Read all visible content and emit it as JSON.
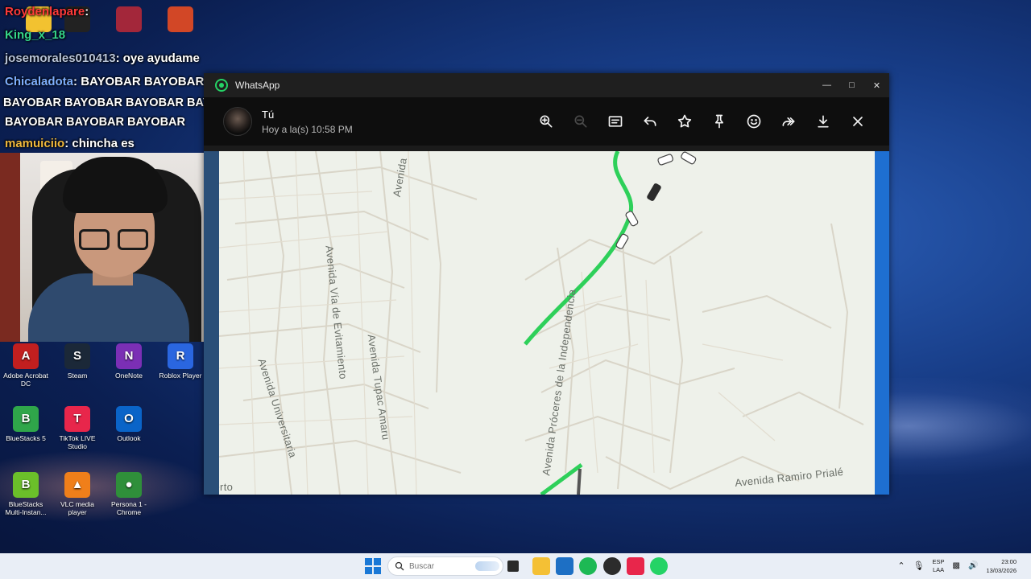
{
  "chat": [
    {
      "user": "Roydenlapare",
      "text": ":",
      "color": "#ff3a3a"
    },
    {
      "user": "King_x_18",
      "text": "",
      "color": "#35d68a"
    },
    {
      "user": "josemorales010413",
      "text": ": oye ayudame",
      "color": "#b8c4d8"
    },
    {
      "user": "Chicaladota",
      "text": ": BAYOBAR BAYOBAR",
      "color": "#7fb0ff"
    },
    {
      "user": "",
      "text": "BAYOBAR BAYOBAR BAYOBAR BAYOBAR",
      "color": "#ffffff"
    },
    {
      "user": "",
      "text": "BAYOBAR BAYOBAR BAYOBAR",
      "color": "#ffffff"
    },
    {
      "user": "mamuiciio",
      "text": ": chincha es",
      "color": "#f0b83c"
    }
  ],
  "desktop_icons": [
    {
      "label": "Adobe Acrobat DC",
      "icon": "acrobat-icon",
      "color": "#c21f1f",
      "glyph": "A"
    },
    {
      "label": "Steam",
      "icon": "steam-icon",
      "color": "#1b2838",
      "glyph": "S"
    },
    {
      "label": "OneNote",
      "icon": "onenote-icon",
      "color": "#7b2fb5",
      "glyph": "N"
    },
    {
      "label": "Roblox Player",
      "icon": "roblox-icon",
      "color": "#2a66e0",
      "glyph": "R"
    },
    {
      "label": "BlueStacks 5",
      "icon": "bluestacks-icon",
      "color": "#2fa64a",
      "glyph": "B"
    },
    {
      "label": "TikTok LIVE Studio",
      "icon": "tiktok-icon",
      "color": "#e8264b",
      "glyph": "T"
    },
    {
      "label": "Outlook",
      "icon": "outlook-icon",
      "color": "#0a64c8",
      "glyph": "O"
    },
    {
      "label": "BlueStacks Multi-Instan...",
      "icon": "bluestacks-multi-icon",
      "color": "#6bbf2a",
      "glyph": "B"
    },
    {
      "label": "VLC media player",
      "icon": "vlc-icon",
      "color": "#f07f1a",
      "glyph": "▲"
    },
    {
      "label": "Persona 1 - Chrome",
      "icon": "chrome-icon",
      "color": "#2f8f3a",
      "glyph": "●"
    }
  ],
  "whatsapp": {
    "window_title": "WhatsApp",
    "sender_name": "Tú",
    "sender_time": "Hoy a la(s) 10:58 PM",
    "toolbar": [
      "zoom-in-icon",
      "zoom-out-icon",
      "caption-icon",
      "reply-icon",
      "star-icon",
      "pin-icon",
      "react-icon",
      "forward-icon",
      "download-icon",
      "close-icon"
    ],
    "accent": "#25d366"
  },
  "map": {
    "labels": {
      "avenida": "Avenida",
      "via_evitamiento": "Avenida Vía de Evitamiento",
      "tupac_amaru": "Avenida Tupac Amaru",
      "universitaria": "Avenida Universitaria",
      "proceres": "Avenida Próceres de la Independencia",
      "ramiro_priale": "Avenida Ramiro Prialé",
      "puerto": "uerto"
    },
    "route_color": "#2ed05a"
  },
  "taskbar": {
    "search_placeholder": "Buscar",
    "lang_top": "ESP",
    "lang_bottom": "LAA",
    "time": "23:00",
    "date": "13/03/2026"
  }
}
